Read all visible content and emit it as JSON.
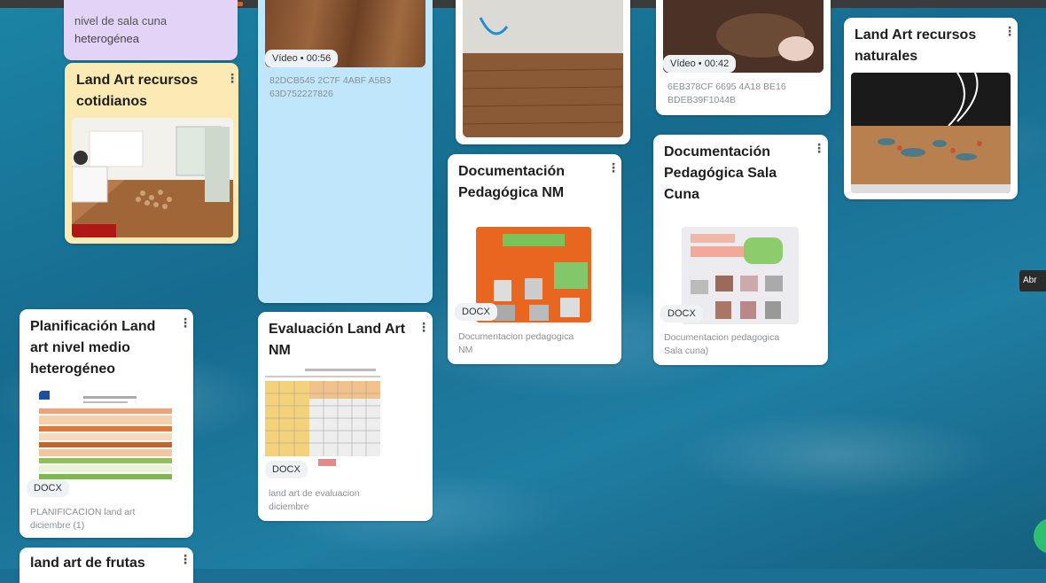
{
  "colors": {
    "purple_card": "#e3d3f7",
    "yellow_card": "#fbeab4",
    "blue_card": "#bfe6fb",
    "docx_badge": "#eef2f5"
  },
  "cards": {
    "top_purple": {
      "title_line1": "nivel de sala cuna",
      "title_line2": "heterogénea"
    },
    "land_art_cotidianos": {
      "title_line1": "Land Art recursos",
      "title_line2": "cotidianos"
    },
    "video1": {
      "badge": "Vídeo • 00:56",
      "caption_line1": "82DCB545 2C7F 4ABF A5B3",
      "caption_line2": "63D752227826"
    },
    "video2": {
      "badge": "Vídeo • 00:42",
      "caption_line1": "6EB378CF 6695 4A18 BE16",
      "caption_line2": "BDEB39F1044B"
    },
    "land_art_naturales": {
      "title_line1": "Land Art recursos",
      "title_line2": "naturales"
    },
    "doc_nm": {
      "title_line1": "Documentación",
      "title_line2": "Pedagógica NM",
      "badge": "DOCX",
      "caption_line1": "Documentacion pedagogica",
      "caption_line2": "NM"
    },
    "doc_sala_cuna": {
      "title_line1": "Documentación",
      "title_line2": "Pedagógica Sala",
      "title_line3": "Cuna",
      "badge": "DOCX",
      "caption_line1": "Documentacion pedagogica",
      "caption_line2": "Sala cuna)"
    },
    "planificacion": {
      "title_line1": "Planificación Land",
      "title_line2": "art nivel medio",
      "title_line3": "heterogéneo",
      "badge": "DOCX",
      "caption_line1": "PLANIFICACION land art",
      "caption_line2": "diciembre (1)"
    },
    "evaluacion": {
      "title_line1": "Evaluación Land Art",
      "title_line2": "NM",
      "badge": "DOCX",
      "caption_line1": "land art de evaluacion",
      "caption_line2": "diciembre"
    },
    "frutas": {
      "title_line1": "land art de frutas"
    }
  },
  "tooltip": {
    "text": "Abr"
  },
  "kebab_glyph": "⋮"
}
